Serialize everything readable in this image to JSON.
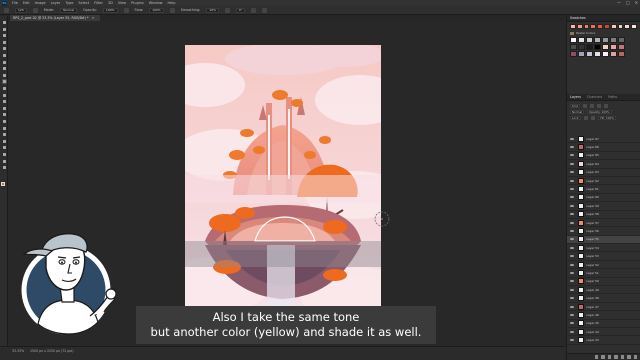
{
  "menubar": {
    "logo": "Ps",
    "items": [
      "File",
      "Edit",
      "Image",
      "Layer",
      "Type",
      "Select",
      "Filter",
      "3D",
      "View",
      "Plugins",
      "Window",
      "Help"
    ],
    "window_buttons": [
      "—",
      "□",
      "✕"
    ]
  },
  "options_bar": {
    "size_value": "125",
    "mode_label": "Mode:",
    "mode_value": "Normal",
    "opacity_label": "Opacity:",
    "opacity_value": "100%",
    "flow_label": "Flow:",
    "flow_value": "100%",
    "smoothing_label": "Smoothing:",
    "smoothing_value": "10%",
    "angle_value": "0°"
  },
  "document": {
    "tab_title": "RPS_2_part 02 @ 33.3% (Layer 55, RGB/8#) *",
    "close": "×"
  },
  "status": {
    "zoom": "33.33%",
    "info": "1500 px x 2250 px (72 ppi)"
  },
  "panels": {
    "top_tabs": [
      "Swatches"
    ],
    "swatch_group": "Pastel Colors",
    "swatch_colors_row1": [
      "#f5b7a7",
      "#f29c84",
      "#f0816a",
      "#ed6e55",
      "#e55b3d",
      "#c94a30",
      "#f7c9bb",
      "#f3d2c6",
      "#f7d9cf",
      "#fbe6df"
    ],
    "swatch_grid": [
      "#ffffff",
      "#e6e6e6",
      "#cccccc",
      "#b3b3b3",
      "#999999",
      "#7f7f7f",
      "#666666",
      "#4d4d4d",
      "#333333",
      "#1a1a1a",
      "#000000",
      "#f2d0c4",
      "#e8a898",
      "#c4757a",
      "#8c4f60",
      "#a8a0b8",
      "#c6c0d6",
      "#e5e0ee",
      "#f7f2f6",
      "#d7a6a0",
      "#b36a5e"
    ],
    "layers_tabs": [
      "Layers",
      "Channels",
      "Paths"
    ],
    "layers_kind": "Kind",
    "layers_blend": "Normal",
    "layers_opacity": "Opacity: 100%",
    "layers_lock": "Lock:",
    "layers_fill": "Fill: 100%",
    "layers": [
      {
        "name": "Layer 67",
        "thumb": "#f0f0f0",
        "selected": false
      },
      {
        "name": "Layer 66",
        "thumb": "#b86a6a",
        "selected": false
      },
      {
        "name": "Layer 65",
        "thumb": "#f0f0f0",
        "selected": false
      },
      {
        "name": "Layer 64",
        "thumb": "#f4d4d0",
        "selected": false
      },
      {
        "name": "Layer 63",
        "thumb": "#f0f0f0",
        "selected": false
      },
      {
        "name": "Layer 62",
        "thumb": "#ee8a6a",
        "selected": false
      },
      {
        "name": "Layer 61",
        "thumb": "#f0f0f0",
        "selected": false
      },
      {
        "name": "Layer 60",
        "thumb": "#f0f0f0",
        "selected": false
      },
      {
        "name": "Layer 59",
        "thumb": "#f0f0f0",
        "selected": false
      },
      {
        "name": "Layer 58",
        "thumb": "#f0f0f0",
        "selected": false
      },
      {
        "name": "Layer 57",
        "thumb": "#ee8a6a",
        "selected": false
      },
      {
        "name": "Layer 56",
        "thumb": "#f0f0f0",
        "selected": false
      },
      {
        "name": "Layer 55",
        "thumb": "#f0f0f0",
        "selected": true
      },
      {
        "name": "Layer 54",
        "thumb": "#f0f0f0",
        "selected": false
      },
      {
        "name": "Layer 53",
        "thumb": "#f0f0f0",
        "selected": false
      },
      {
        "name": "Layer 52",
        "thumb": "#f0f0f0",
        "selected": false
      },
      {
        "name": "Layer 51",
        "thumb": "#f0f0f0",
        "selected": false
      },
      {
        "name": "Layer 50",
        "thumb": "#ee8a6a",
        "selected": false
      },
      {
        "name": "Layer 49",
        "thumb": "#f0f0f0",
        "selected": false
      },
      {
        "name": "Layer 48",
        "thumb": "#f0f0f0",
        "selected": false
      },
      {
        "name": "Layer 47",
        "thumb": "#b86a6a",
        "selected": false
      },
      {
        "name": "Layer 46",
        "thumb": "#f0f0f0",
        "selected": false
      },
      {
        "name": "Layer 45",
        "thumb": "#f0f0f0",
        "selected": false
      },
      {
        "name": "Layer 44",
        "thumb": "#f0f0f0",
        "selected": false
      },
      {
        "name": "Layer 43",
        "thumb": "#f0f0f0",
        "selected": false
      }
    ]
  },
  "subtitle": {
    "line1": "Also I take the same tone",
    "line2": "but another color (yellow) and shade it as well."
  },
  "colors": {
    "foreground": "#e26a3c",
    "background": "#ffffff",
    "accent_orange": "#ee6a2a"
  }
}
